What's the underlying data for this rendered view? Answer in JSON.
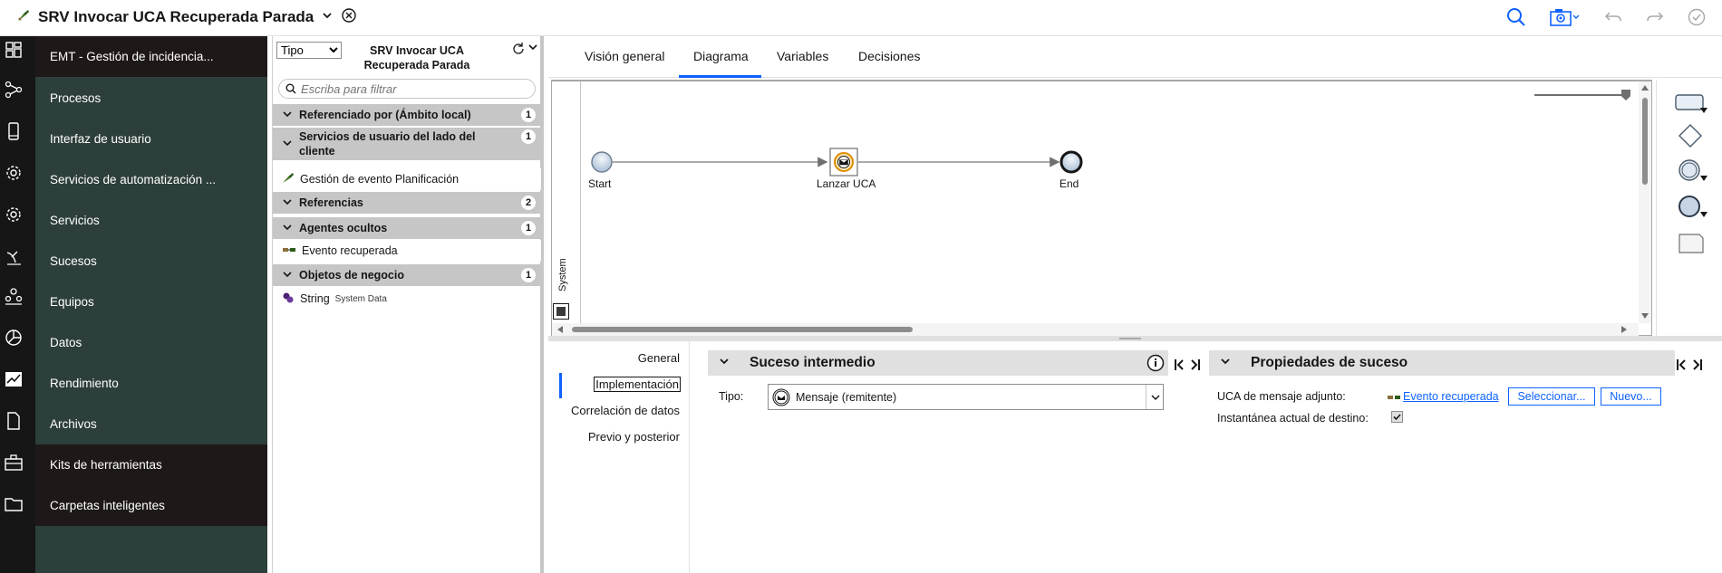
{
  "header": {
    "title": "SRV Invocar UCA Recuperada Parada"
  },
  "nav": {
    "items": [
      {
        "label": "EMT - Gestión de incidencia..."
      },
      {
        "label": "Procesos"
      },
      {
        "label": "Interfaz de usuario"
      },
      {
        "label": "Servicios de automatización ..."
      },
      {
        "label": "Servicios"
      },
      {
        "label": "Sucesos"
      },
      {
        "label": "Equipos"
      },
      {
        "label": "Datos"
      },
      {
        "label": "Rendimiento"
      },
      {
        "label": "Archivos"
      },
      {
        "label": "Kits de herramientas"
      },
      {
        "label": "Carpetas inteligentes"
      }
    ]
  },
  "library": {
    "type_select": "Tipo",
    "title": "SRV Invocar UCA Recuperada Parada",
    "filter_placeholder": "Escriba para filtrar",
    "sections": [
      {
        "label": "Referenciado por (Ámbito local)",
        "count": "1"
      },
      {
        "label": "Servicios de usuario del lado del cliente",
        "count": "1"
      },
      {
        "label": "Referencias",
        "count": "2"
      },
      {
        "label": "Agentes ocultos",
        "count": "1"
      },
      {
        "label": "Objetos de negocio",
        "count": "1"
      }
    ],
    "items": {
      "gestion": "Gestión de evento Planificación",
      "evento": "Evento recuperada",
      "string": "String",
      "string_tag": "System Data"
    }
  },
  "tabs": [
    "Visión general",
    "Diagrama",
    "Variables",
    "Decisiones"
  ],
  "diagram": {
    "start": "Start",
    "task": "Lanzar UCA",
    "end": "End",
    "lane": "System"
  },
  "props": {
    "tabs": [
      "General",
      "Implementación",
      "Correlación de datos",
      "Previo y posterior"
    ],
    "intermediate_header": "Suceso intermedio",
    "type_label": "Tipo:",
    "type_value": "Mensaje (remitente)",
    "event_header": "Propiedades de suceso",
    "uca_label": "UCA de mensaje adjunto:",
    "uca_link": "Evento recuperada",
    "select_button": "Seleccionar...",
    "new_button": "Nuevo...",
    "snapshot_label": "Instantánea actual de destino:",
    "snapshot_checked": true
  }
}
